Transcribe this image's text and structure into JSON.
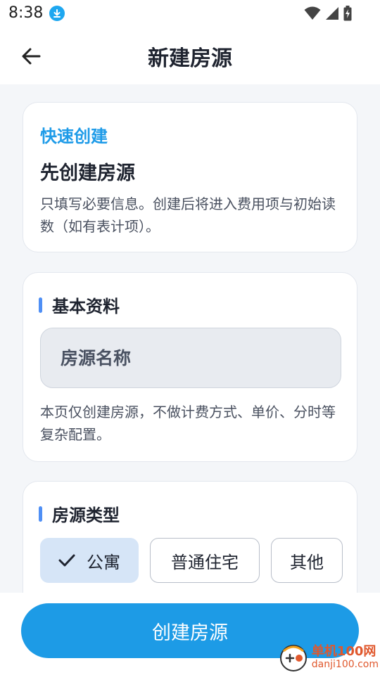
{
  "status_bar": {
    "time": "8:38",
    "icons": [
      "download-badge-icon",
      "wifi-icon",
      "cellular-signal-icon",
      "battery-charging-icon"
    ]
  },
  "app_bar": {
    "title": "新建房源",
    "back_icon": "arrow-left-icon"
  },
  "intro_card": {
    "kicker": "快速创建",
    "headline": "先创建房源",
    "description": "只填写必要信息。创建后将进入费用项与初始读数（如有表计项）。"
  },
  "basic_info": {
    "section_title": "基本资料",
    "name_field": {
      "placeholder": "房源名称",
      "value": ""
    },
    "note": "本页仅创建房源，不做计费方式、单价、分时等复杂配置。"
  },
  "property_type": {
    "section_title": "房源类型",
    "options": [
      {
        "label": "公寓",
        "selected": true
      },
      {
        "label": "普通住宅",
        "selected": false
      },
      {
        "label": "其他",
        "selected": false
      }
    ]
  },
  "bottom_bar": {
    "primary_button_label": "创建房源"
  },
  "watermark": {
    "name": "单机100网",
    "url": "danji100.com"
  },
  "colors": {
    "accent": "#1d9be6",
    "kicker": "#1e9be8",
    "section_bar": "#4f8ff5",
    "chip_selected_bg": "#d6e5f7",
    "background": "#f4f6f9"
  }
}
